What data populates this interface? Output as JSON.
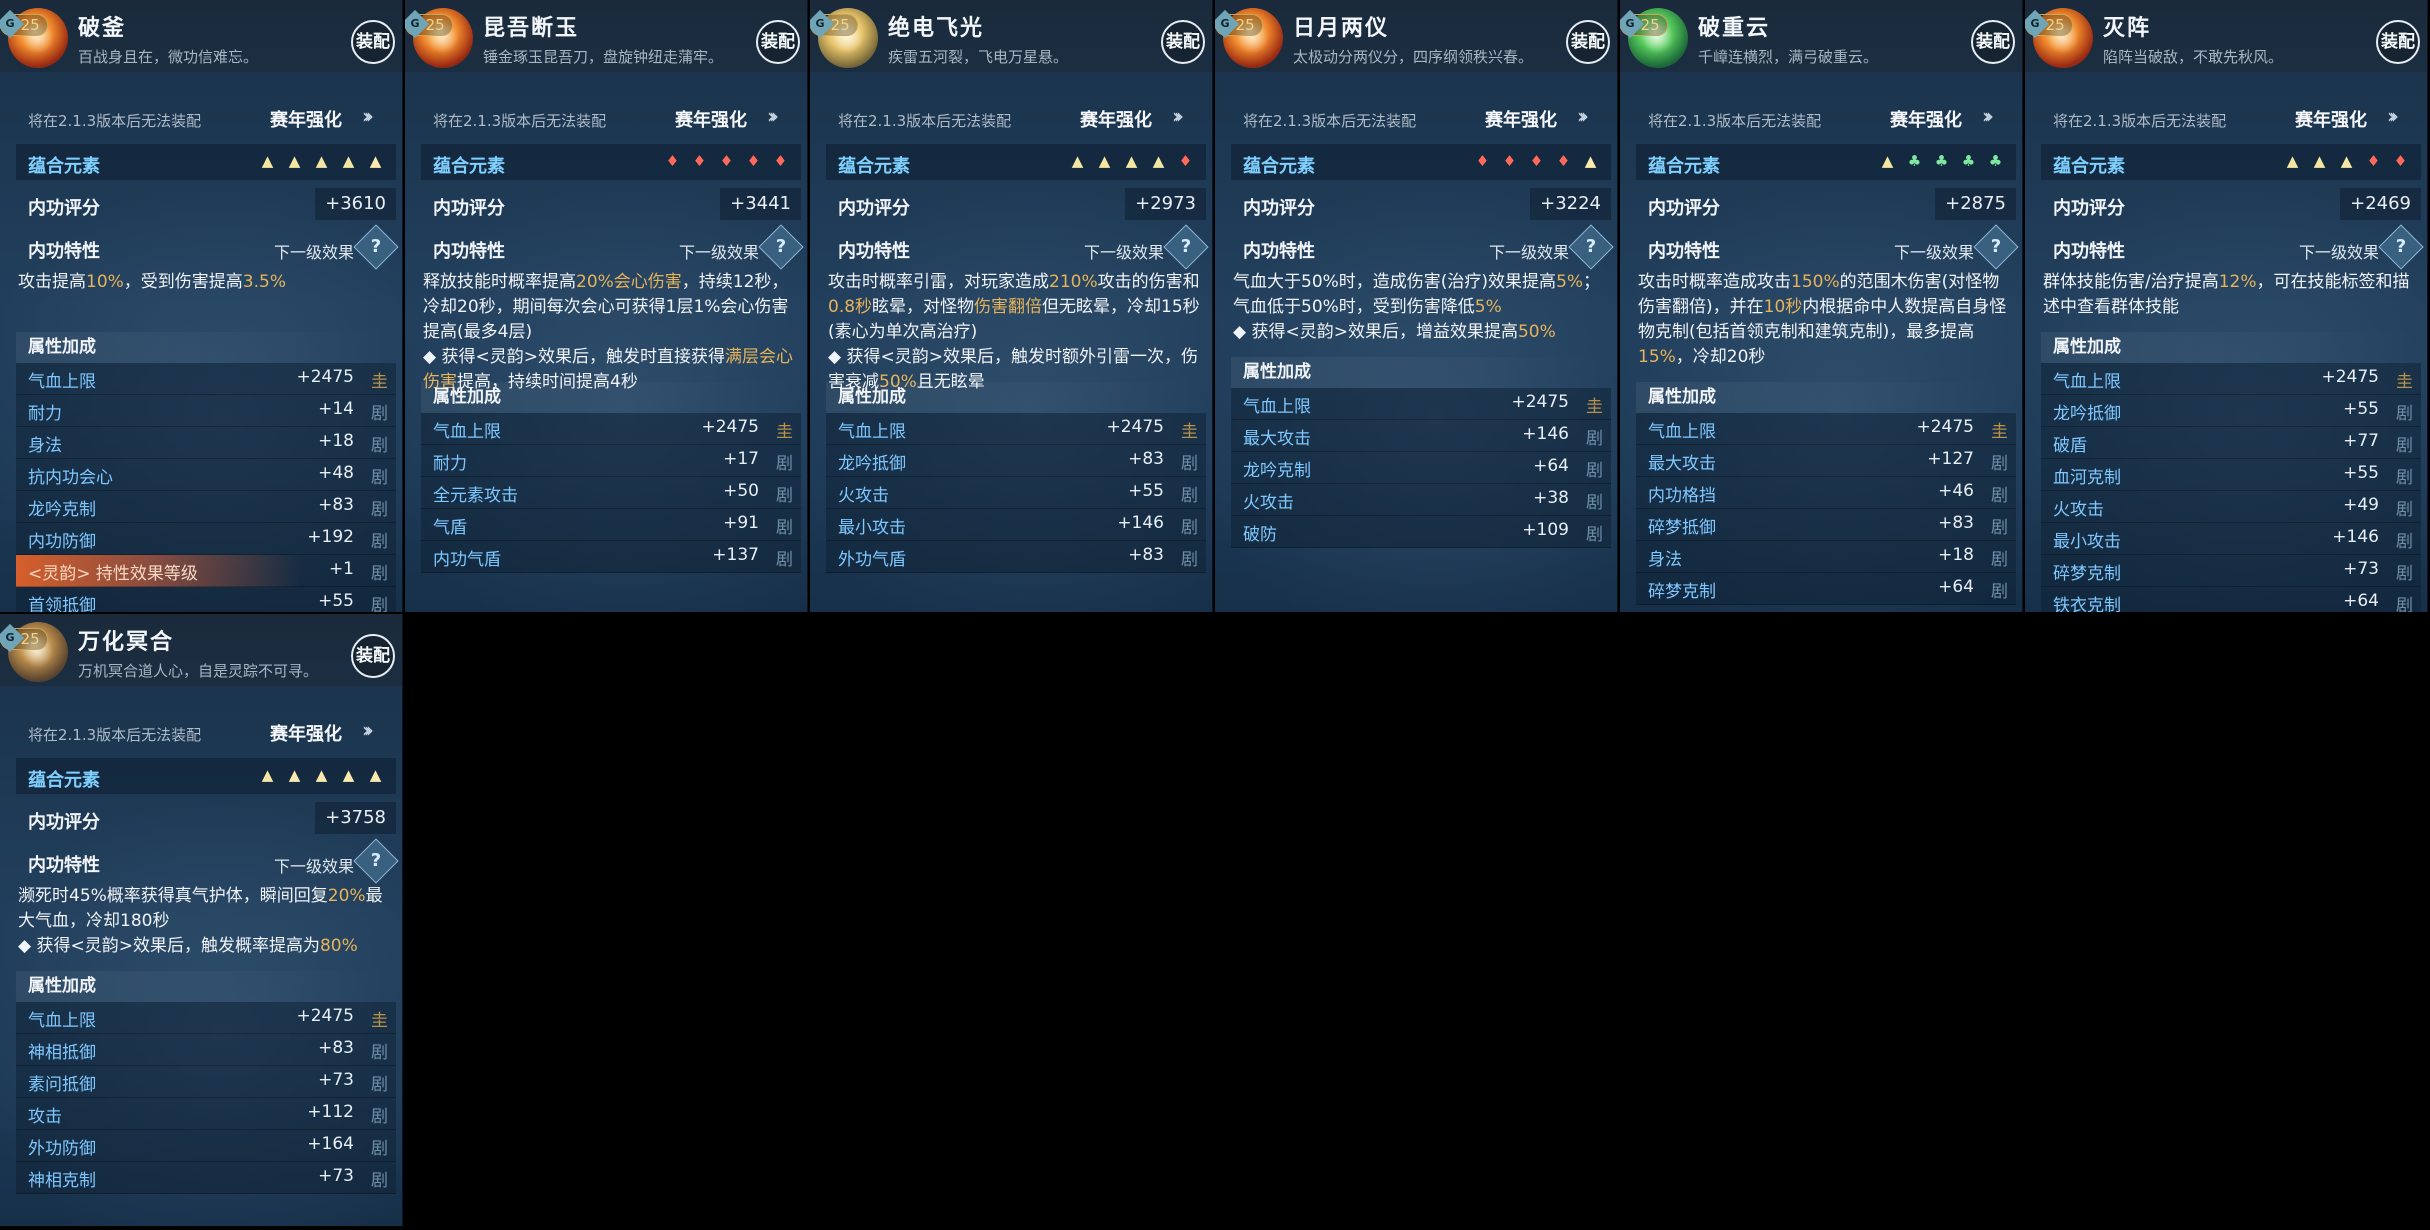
{
  "cards": [
    {
      "gem": "fire",
      "name": "破釜",
      "level": "+25",
      "tag": "G",
      "desc": "百战身且在，微功信难忘。",
      "equip": "装配",
      "notice": "将在2.1.3版本后无法装配",
      "season": "赛年强化",
      "elem_label": "蕴合元素",
      "elements": [
        "light",
        "light",
        "light",
        "light",
        "ice"
      ],
      "score_label": "内功评分",
      "score": "+3610",
      "trait_label": "内功特性",
      "next_label": "下一级效果",
      "effect": [
        {
          "t": "攻击提高"
        },
        {
          "t": "10%",
          "hi": true
        },
        {
          "t": "，受到伤害提高"
        },
        {
          "t": "3.5%",
          "hi": true
        }
      ],
      "attrs_title": "属性加成",
      "attrs": [
        {
          "name": "气血上限",
          "value": "+2475",
          "icon": "圭",
          "gold": true
        },
        {
          "name": "耐力",
          "value": "+14",
          "icon": "剧"
        },
        {
          "name": "身法",
          "value": "+18",
          "icon": "剧"
        },
        {
          "name": "抗内功会心",
          "value": "+48",
          "icon": "剧"
        },
        {
          "name": "龙吟克制",
          "value": "+83",
          "icon": "剧"
        },
        {
          "name": "内功防御",
          "value": "+192",
          "icon": "剧"
        },
        {
          "name": "<灵韵> 持性效果等级",
          "value": "+1",
          "icon": "剧",
          "flame": true
        },
        {
          "name": "首领抵御",
          "value": "+55",
          "icon": "剧"
        }
      ]
    },
    {
      "gem": "fire",
      "name": "昆吾断玉",
      "level": "+25",
      "tag": "G",
      "desc": "锤金琢玉昆吾刀，盘旋钟纽走蒲牢。",
      "equip": "装配",
      "notice": "将在2.1.3版本后无法装配",
      "season": "赛年强化",
      "elem_label": "蕴合元素",
      "elements": [
        "fire",
        "fire",
        "fire",
        "fire",
        "fire"
      ],
      "score_label": "内功评分",
      "score": "+3441",
      "trait_label": "内功特性",
      "next_label": "下一级效果",
      "effect": [
        {
          "t": "释放技能时概率提高"
        },
        {
          "t": "20%会心伤害",
          "hi": true
        },
        {
          "t": "，持续12秒，冷却20秒，期间每次会心可获得1层1%会心伤害提高(最多4层)"
        },
        {
          "t": "\n◆ 获得<灵韵>效果后，触发时直接获得"
        },
        {
          "t": "满层会心伤害",
          "hi": true
        },
        {
          "t": "提高，持续时间提高4秒"
        }
      ],
      "attrs_title": "属性加成",
      "attrs": [
        {
          "name": "气血上限",
          "value": "+2475",
          "icon": "圭",
          "gold": true
        },
        {
          "name": "耐力",
          "value": "+17",
          "icon": "剧"
        },
        {
          "name": "全元素攻击",
          "value": "+50",
          "icon": "剧"
        },
        {
          "name": "气盾",
          "value": "+91",
          "icon": "剧"
        },
        {
          "name": "内功气盾",
          "value": "+137",
          "icon": "剧"
        }
      ]
    },
    {
      "gem": "light",
      "name": "绝电飞光",
      "level": "+25",
      "tag": "G",
      "desc": "疾雷五河裂，飞电万星悬。",
      "equip": "装配",
      "notice": "将在2.1.3版本后无法装配",
      "season": "赛年强化",
      "elem_label": "蕴合元素",
      "elements": [
        "light",
        "light",
        "light",
        "light",
        "fire"
      ],
      "score_label": "内功评分",
      "score": "+2973",
      "trait_label": "内功特性",
      "next_label": "下一级效果",
      "effect": [
        {
          "t": "攻击时概率引雷，对玩家造成"
        },
        {
          "t": "210%",
          "hi": true
        },
        {
          "t": "攻击的伤害和"
        },
        {
          "t": "0.8秒",
          "hi": true
        },
        {
          "t": "眩晕，对怪物"
        },
        {
          "t": "伤害翻倍",
          "hi": true
        },
        {
          "t": "但无眩晕，冷却15秒(素心为单次高治疗)"
        },
        {
          "t": "\n◆ 获得<灵韵>效果后，触发时额外引雷一次，伤害衰减"
        },
        {
          "t": "50%",
          "hi": true
        },
        {
          "t": "且无眩晕"
        }
      ],
      "attrs_title": "属性加成",
      "attrs": [
        {
          "name": "气血上限",
          "value": "+2475",
          "icon": "圭",
          "gold": true
        },
        {
          "name": "龙吟抵御",
          "value": "+83",
          "icon": "剧"
        },
        {
          "name": "火攻击",
          "value": "+55",
          "icon": "剧"
        },
        {
          "name": "最小攻击",
          "value": "+146",
          "icon": "剧"
        },
        {
          "name": "外功气盾",
          "value": "+83",
          "icon": "剧"
        }
      ]
    },
    {
      "gem": "fire",
      "name": "日月两仪",
      "level": "+25",
      "tag": "G",
      "desc": "太极动分两仪分，四序纲领秩兴春。",
      "equip": "装配",
      "notice": "将在2.1.3版本后无法装配",
      "season": "赛年强化",
      "elem_label": "蕴合元素",
      "elements": [
        "fire",
        "fire",
        "fire",
        "fire",
        "ice"
      ],
      "score_label": "内功评分",
      "score": "+3224",
      "trait_label": "内功特性",
      "next_label": "下一级效果",
      "effect": [
        {
          "t": "气血大于50%时，造成伤害(治疗)效果提高"
        },
        {
          "t": "5%",
          "hi": true
        },
        {
          "t": "；气血低于50%时，受到伤害降低"
        },
        {
          "t": "5%",
          "hi": true
        },
        {
          "t": "\n◆ 获得<灵韵>效果后，增益效果提高"
        },
        {
          "t": "50%",
          "hi": true
        }
      ],
      "attrs_title": "属性加成",
      "attrs": [
        {
          "name": "气血上限",
          "value": "+2475",
          "icon": "圭",
          "gold": true
        },
        {
          "name": "最大攻击",
          "value": "+146",
          "icon": "剧"
        },
        {
          "name": "龙吟克制",
          "value": "+64",
          "icon": "剧"
        },
        {
          "name": "火攻击",
          "value": "+38",
          "icon": "剧"
        },
        {
          "name": "破防",
          "value": "+109",
          "icon": "剧"
        }
      ]
    },
    {
      "gem": "green",
      "name": "破重云",
      "level": "+25",
      "tag": "G",
      "desc": "千嶂连横烈，满弓破重云。",
      "equip": "装配",
      "notice": "将在2.1.3版本后无法装配",
      "season": "赛年强化",
      "elem_label": "蕴合元素",
      "elements": [
        "light",
        "green",
        "green",
        "green",
        "green"
      ],
      "score_label": "内功评分",
      "score": "+2875",
      "trait_label": "内功特性",
      "next_label": "下一级效果",
      "effect": [
        {
          "t": "攻击时概率造成攻击"
        },
        {
          "t": "150%",
          "hi": true
        },
        {
          "t": "的范围木伤害(对怪物伤害翻倍)，并在"
        },
        {
          "t": "10秒",
          "hi": true
        },
        {
          "t": "内根据命中人数提高自身怪物克制(包括首领克制和建筑克制)，最多提高"
        },
        {
          "t": "15%",
          "hi": true
        },
        {
          "t": "，冷却20秒"
        }
      ],
      "attrs_title": "属性加成",
      "attrs": [
        {
          "name": "气血上限",
          "value": "+2475",
          "icon": "圭",
          "gold": true
        },
        {
          "name": "最大攻击",
          "value": "+127",
          "icon": "剧"
        },
        {
          "name": "内功格挡",
          "value": "+46",
          "icon": "剧"
        },
        {
          "name": "碎梦抵御",
          "value": "+83",
          "icon": "剧"
        },
        {
          "name": "身法",
          "value": "+18",
          "icon": "剧"
        },
        {
          "name": "碎梦克制",
          "value": "+64",
          "icon": "剧"
        }
      ]
    },
    {
      "gem": "fire",
      "name": "灭阵",
      "level": "+25",
      "tag": "G",
      "desc": "陷阵当破敌，不敢先秋风。",
      "equip": "装配",
      "notice": "将在2.1.3版本后无法装配",
      "season": "赛年强化",
      "elem_label": "蕴合元素",
      "elements": [
        "light",
        "light",
        "light",
        "fire",
        "fire"
      ],
      "score_label": "内功评分",
      "score": "+2469",
      "trait_label": "内功特性",
      "next_label": "下一级效果",
      "effect": [
        {
          "t": "群体技能伤害/治疗提高"
        },
        {
          "t": "12%",
          "hi": true
        },
        {
          "t": "，可在技能标签和描述中查看群体技能"
        }
      ],
      "attrs_title": "属性加成",
      "attrs": [
        {
          "name": "气血上限",
          "value": "+2475",
          "icon": "圭",
          "gold": true
        },
        {
          "name": "龙吟抵御",
          "value": "+55",
          "icon": "剧"
        },
        {
          "name": "破盾",
          "value": "+77",
          "icon": "剧"
        },
        {
          "name": "血河克制",
          "value": "+55",
          "icon": "剧"
        },
        {
          "name": "火攻击",
          "value": "+49",
          "icon": "剧"
        },
        {
          "name": "最小攻击",
          "value": "+146",
          "icon": "剧"
        },
        {
          "name": "碎梦克制",
          "value": "+73",
          "icon": "剧"
        },
        {
          "name": "铁衣克制",
          "value": "+64",
          "icon": "剧"
        }
      ]
    },
    {
      "gem": "orb",
      "name": "万化冥合",
      "level": "+25",
      "tag": "G",
      "desc": "万机冥合道人心，自是灵踪不可寻。",
      "equip": "装配",
      "notice": "将在2.1.3版本后无法装配",
      "season": "赛年强化",
      "elem_label": "蕴合元素",
      "elements": [
        "light",
        "ice",
        "ice",
        "ice",
        "ice"
      ],
      "score_label": "内功评分",
      "score": "+3758",
      "trait_label": "内功特性",
      "next_label": "下一级效果",
      "effect": [
        {
          "t": "濒死时45%概率获得真气护体，瞬间回复"
        },
        {
          "t": "20%",
          "hi": true
        },
        {
          "t": "最大气血，冷却180秒"
        },
        {
          "t": "\n◆ 获得<灵韵>效果后，触发概率提高为"
        },
        {
          "t": "80%",
          "hi": true
        }
      ],
      "attrs_title": "属性加成",
      "attrs": [
        {
          "name": "气血上限",
          "value": "+2475",
          "icon": "圭",
          "gold": true
        },
        {
          "name": "神相抵御",
          "value": "+83",
          "icon": "剧"
        },
        {
          "name": "素问抵御",
          "value": "+73",
          "icon": "剧"
        },
        {
          "name": "攻击",
          "value": "+112",
          "icon": "剧"
        },
        {
          "name": "外功防御",
          "value": "+164",
          "icon": "剧"
        },
        {
          "name": "神相克制",
          "value": "+73",
          "icon": "剧"
        }
      ]
    }
  ]
}
